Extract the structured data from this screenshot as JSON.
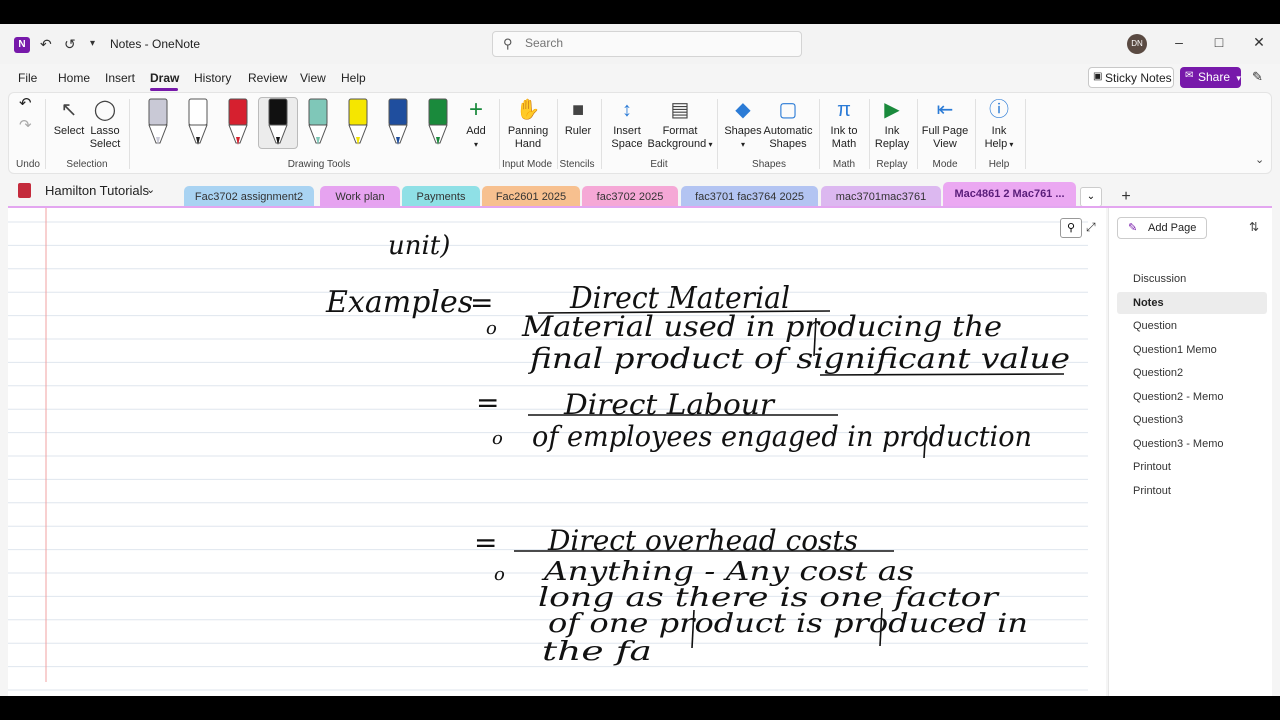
{
  "titlebar": {
    "title": "Notes  -  OneNote",
    "search_placeholder": "Search",
    "avatar_initials": "DN"
  },
  "menu": {
    "items": [
      "File",
      "Home",
      "Insert",
      "Draw",
      "History",
      "Review",
      "View",
      "Help"
    ],
    "active": "Draw",
    "sticky_notes": "Sticky Notes",
    "share": "Share"
  },
  "ribbon": {
    "undo_group": "Undo",
    "selection": {
      "select": "Select",
      "lasso_line1": "Lasso",
      "lasso_line2": "Select",
      "group": "Selection"
    },
    "drawing_tools_group": "Drawing Tools",
    "add_label": "Add",
    "input_mode": {
      "panning_line1": "Panning",
      "panning_line2": "Hand",
      "group": "Input Mode"
    },
    "stencils": {
      "ruler": "Ruler",
      "group": "Stencils"
    },
    "edit": {
      "insert_space_line1": "Insert",
      "insert_space_line2": "Space",
      "format_bg_line1": "Format",
      "format_bg_line2": "Background",
      "group": "Edit"
    },
    "shapes": {
      "shapes": "Shapes",
      "auto_line1": "Automatic",
      "auto_line2": "Shapes",
      "group": "Shapes"
    },
    "math": {
      "ink_line1": "Ink to",
      "ink_line2": "Math",
      "group": "Math"
    },
    "replay": {
      "line1": "Ink",
      "line2": "Replay",
      "group": "Replay"
    },
    "mode": {
      "line1": "Full Page",
      "line2": "View",
      "group": "Mode"
    },
    "help": {
      "line1": "Ink",
      "line2": "Help",
      "group": "Help"
    },
    "pen_colors": [
      "#c9c9d6",
      "#ffffff",
      "#d6202f",
      "#111111",
      "#7fc7b8",
      "#f5e600",
      "#1f4e9e",
      "#1a8a3c"
    ]
  },
  "notebook": {
    "name": "Hamilton Tutorials",
    "sections": [
      {
        "label": "Fac3702 assignment2",
        "color": "#a9d3f2"
      },
      {
        "label": "Work plan",
        "color": "#e6a3f0"
      },
      {
        "label": "Payments",
        "color": "#8fe0e6"
      },
      {
        "label": "Fac2601 2025",
        "color": "#f7c08f"
      },
      {
        "label": "fac3702 2025",
        "color": "#f5a8d6"
      },
      {
        "label": "fac3701 fac3764 2025",
        "color": "#b3c4f2"
      },
      {
        "label": "mac3701mac3761",
        "color": "#dcb8f0"
      },
      {
        "label": "Mac4861 2 Mac761 ...",
        "color": "#eba8f2"
      }
    ],
    "active_section": "Mac4861 2 Mac761 ..."
  },
  "pages": {
    "add_page": "Add Page",
    "items": [
      "Discussion",
      "Notes",
      "Question",
      "Question1 Memo",
      "Question2",
      "Question2 - Memo",
      "Question3",
      "Question3 - Memo",
      "Printout",
      "Printout"
    ],
    "active": "Notes"
  },
  "ink": {
    "line_unit": "unit)",
    "heading": "Examples",
    "direct_material": "Direct Material",
    "dm_line1": "Material used in producing the",
    "dm_line2": "final product of significant value",
    "direct_labour": "Direct Labour",
    "dl_line1": "of employees engaged in production",
    "direct_overhead": "Direct overhead costs",
    "oh_line1": "Anything - Any cost as",
    "oh_line2": "long as there is one factor",
    "oh_line3": "of one product is produced in",
    "oh_line4": "the fa"
  },
  "colors": {
    "accent": "#7719aa",
    "notebook_icon": "#c42b3c",
    "rule_line": "#dfe6ee",
    "margin_line": "#f0a0a0"
  }
}
